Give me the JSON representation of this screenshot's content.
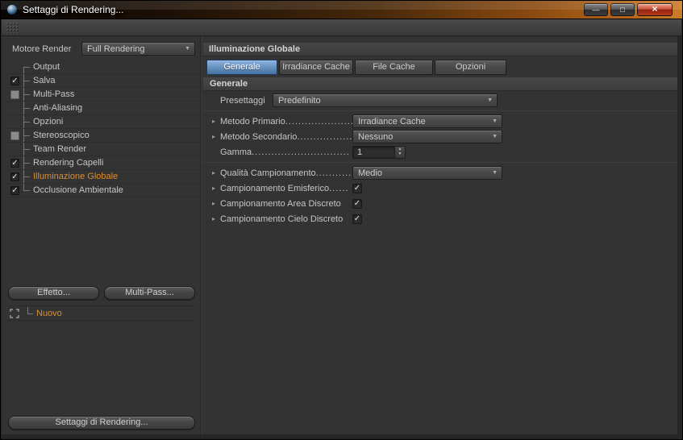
{
  "colors": {
    "accent-orange": "#d98f2f",
    "tab-active-top": "#8db3e2",
    "tab-active-bottom": "#44719f",
    "close-red": "#c23b22"
  },
  "window": {
    "title": "Settaggi di Rendering...",
    "buttons": {
      "minimize": "—",
      "maximize": "□",
      "close": "×"
    }
  },
  "icons": {
    "disclosure": "▸",
    "dropdown_arrow": "▼",
    "spinner_up": "▲",
    "spinner_down": "▼"
  },
  "sidebar": {
    "engine_label": "Motore Render",
    "engine_value": "Full Rendering",
    "items": [
      {
        "label": "Output",
        "check": ""
      },
      {
        "label": "Salva",
        "check": "✓"
      },
      {
        "label": "Multi-Pass",
        "check": ""
      },
      {
        "label": "Anti-Aliasing",
        "check": ""
      },
      {
        "label": "Opzioni",
        "check": ""
      },
      {
        "label": "Stereoscopico",
        "check": ""
      },
      {
        "label": "Team Render",
        "check": ""
      },
      {
        "label": "Rendering Capelli",
        "check": "✓"
      },
      {
        "label": "Illuminazione Globale",
        "check": "✓"
      },
      {
        "label": "Occlusione Ambientale",
        "check": "✓"
      }
    ],
    "effect_button": "Effetto...",
    "multipass_button": "Multi-Pass...",
    "new_item": "Nuovo",
    "render_settings_button": "Settaggi di Rendering..."
  },
  "main": {
    "header": "Illuminazione Globale",
    "tabs": [
      {
        "label": "Generale"
      },
      {
        "label": "Irradiance Cache"
      },
      {
        "label": "File Cache"
      },
      {
        "label": "Opzioni"
      }
    ],
    "section_title": "Generale",
    "params": {
      "presettaggi": {
        "label": "Presettaggi",
        "value": "Predefinito"
      },
      "metodo_primario": {
        "label": "Metodo Primario",
        "leader": "..............................",
        "value": "Irradiance Cache"
      },
      "metodo_secondario": {
        "label": "Metodo Secondario",
        "leader": "..............................",
        "value": "Nessuno"
      },
      "gamma": {
        "label": "Gamma",
        "leader": "..............................",
        "value": "1"
      },
      "qualita_campionamento": {
        "label": "Qualità Campionamento",
        "leader": "..............................",
        "value": "Medio"
      },
      "campionamento_emisferico": {
        "label": "Campionamento Emisferico",
        "leader": "......",
        "check": "✓"
      },
      "campionamento_area": {
        "label": "Campionamento Area Discreto",
        "leader": "",
        "check": "✓"
      },
      "campionamento_cielo": {
        "label": "Campionamento Cielo Discreto",
        "leader": "",
        "check": "✓"
      }
    }
  }
}
